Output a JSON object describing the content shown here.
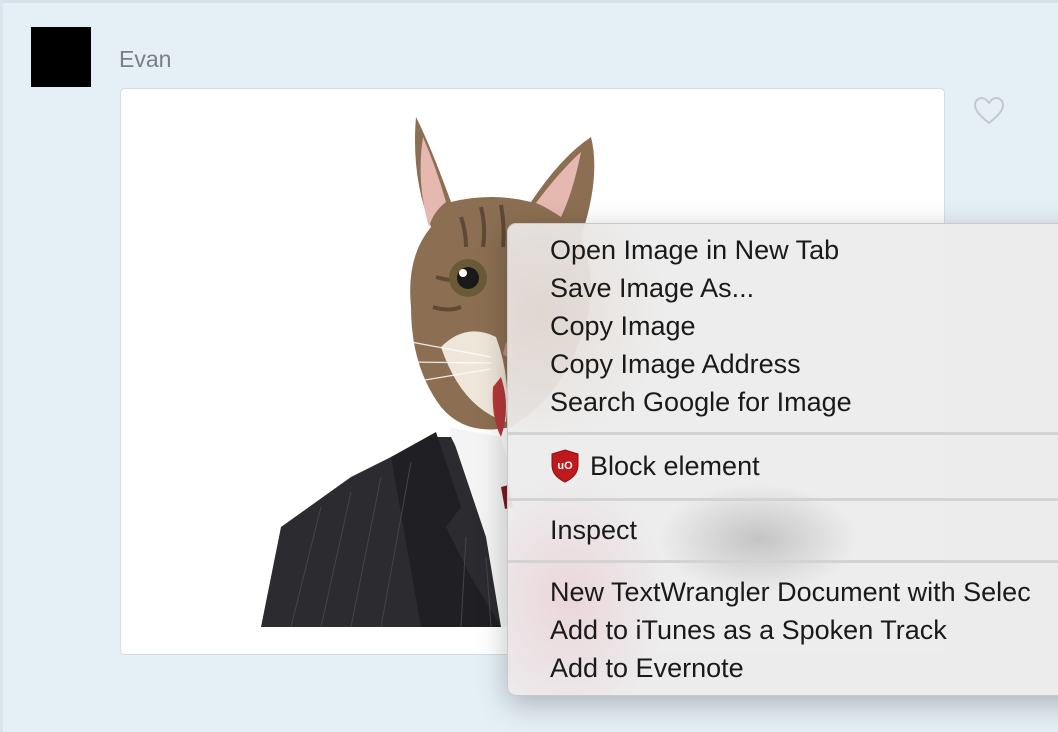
{
  "post": {
    "author": "Evan"
  },
  "context_menu": {
    "group1": [
      "Open Image in New Tab",
      "Save Image As...",
      "Copy Image",
      "Copy Image Address",
      "Search Google for Image"
    ],
    "block_element": "Block element",
    "inspect": "Inspect",
    "group3": [
      "New TextWrangler Document with Selec",
      "Add to iTunes as a Spoken Track",
      "Add to Evernote"
    ]
  },
  "colors": {
    "background": "#e5eff6",
    "ublock_red": "#c0191c"
  },
  "icons": [
    "heart-icon",
    "ublock-shield-icon"
  ]
}
